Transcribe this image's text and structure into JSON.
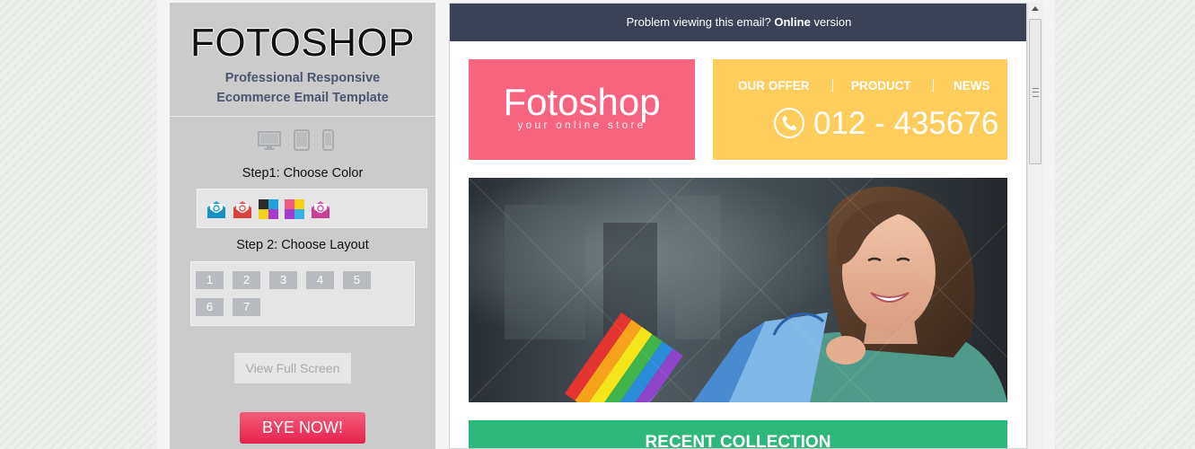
{
  "sidebar": {
    "brand": "FOTOSHOP",
    "tagline_line1": "Professional Responsive",
    "tagline_line2": "Ecommerce Email Template",
    "device_icons": [
      "desktop-icon",
      "tablet-icon",
      "mobile-icon"
    ],
    "step1_label": "Step1: Choose Color",
    "color_swatches": [
      {
        "name": "blue-envelope",
        "color": "#1fa3d9"
      },
      {
        "name": "red-envelope",
        "color": "#f0524b"
      },
      {
        "name": "multicolor-squares-1",
        "colors": [
          "#2b2b2b",
          "#1fa3d9",
          "#f7d117",
          "#a63bd1"
        ]
      },
      {
        "name": "multicolor-squares-2",
        "colors": [
          "#f05a7e",
          "#f7d117",
          "#a63bd1",
          "#37b3e8"
        ]
      },
      {
        "name": "pink-envelope",
        "color": "#e04fa8"
      }
    ],
    "step2_label": "Step 2: Choose Layout",
    "layouts": [
      "1",
      "2",
      "3",
      "4",
      "5",
      "6",
      "7"
    ],
    "fullscreen_label": "View Full Screen",
    "buy_label": "BYE NOW!"
  },
  "email": {
    "topbar_text": "Problem viewing this email?",
    "topbar_link": "Online",
    "topbar_suffix": "version",
    "logo_title": "Fotoshop",
    "logo_subtitle": "your online store",
    "nav": [
      "OUR OFFER",
      "PRODUCT",
      "NEWS"
    ],
    "phone": "012 - 435676",
    "section_title": "RECENT COLLECTION"
  },
  "colors": {
    "panel_bg": "#cbcbcb",
    "topbar_bg": "#3c4255",
    "logo_bg": "#f7647f",
    "nav_bg": "#fecd5c",
    "section_bg": "#2eb77a",
    "buy_button": "#e5234d"
  }
}
